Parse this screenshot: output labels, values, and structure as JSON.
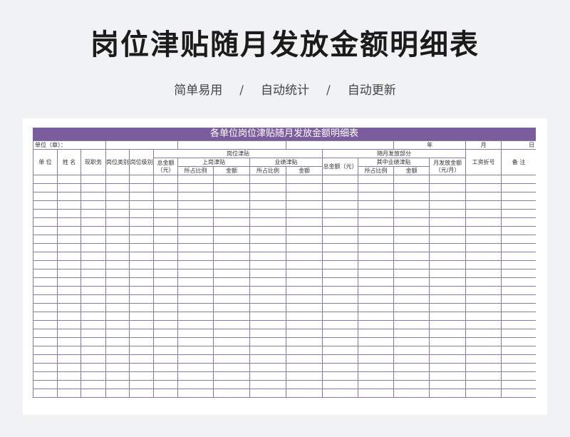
{
  "hero": {
    "title": "岗位津贴随月发放金额明细表",
    "features": [
      "简单易用",
      "自动统计",
      "自动更新"
    ],
    "separator": "/"
  },
  "sheet": {
    "title": "各单位岗位津贴随月发放金额明细表",
    "unit_label": "单位（章）：",
    "date_year": "年",
    "date_month": "月",
    "date_day": "日",
    "columns": {
      "unit": "单    位",
      "name": "姓    名",
      "current_job": "现职务",
      "post_category": "岗位类别",
      "post_level": "岗位级别",
      "post_allowance_group": "岗位津贴",
      "total_amount": "总金额（元）",
      "on_post_allowance": "上岗津贴",
      "performance_allowance": "业绩津贴",
      "ratio": "所占比例",
      "amount": "金额",
      "monthly_group": "随月发放部分",
      "monthly_total": "总金额（元）",
      "of_which_performance": "其中业绩津贴",
      "monthly_amount": "月发放金额（元/月）",
      "wage_account": "工资折号",
      "remarks": "备    注"
    },
    "accent_color": "#7b5d9e",
    "grid_color": "#8a77aa",
    "body_rows": 26
  }
}
